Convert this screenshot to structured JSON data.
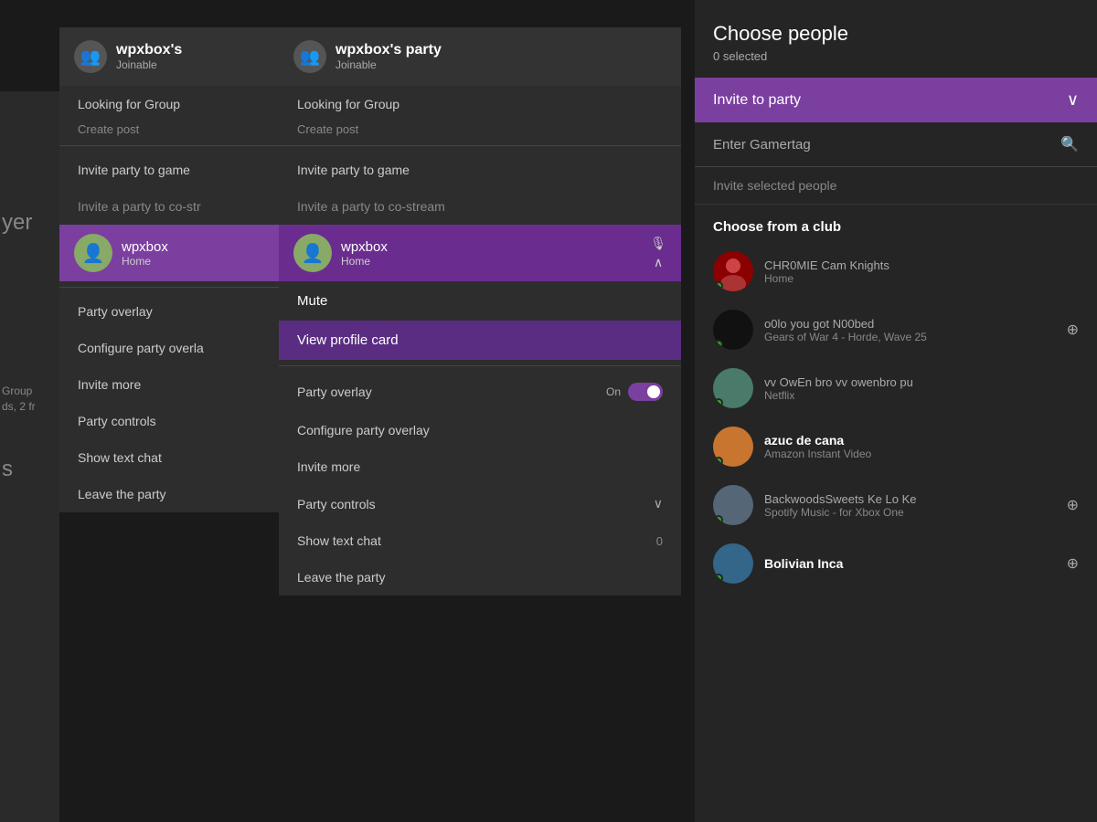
{
  "left_edge": {
    "yer": "yer",
    "group_label": "Group\nds, 2 fr",
    "s": "s"
  },
  "panel1": {
    "header": {
      "name": "wpxbox's",
      "status": "Joinable"
    },
    "menu_items": [
      {
        "label": "Looking for Group",
        "type": "main"
      },
      {
        "label": "Create post",
        "type": "sub"
      },
      {
        "label": "Invite party to game",
        "type": "main"
      },
      {
        "label": "Invite a party to co-str",
        "type": "main"
      },
      {
        "label": "Party overlay",
        "type": "main"
      },
      {
        "label": "Configure party overla",
        "type": "main"
      },
      {
        "label": "Invite more",
        "type": "main"
      },
      {
        "label": "Party controls",
        "type": "main"
      },
      {
        "label": "Show text chat",
        "type": "main"
      },
      {
        "label": "Leave the party",
        "type": "main"
      }
    ],
    "member": {
      "name": "wpxbox",
      "status": "Home"
    }
  },
  "panel2": {
    "header": {
      "name": "wpxbox's party",
      "status": "Joinable"
    },
    "menu_items": [
      {
        "label": "Looking for Group",
        "type": "main"
      },
      {
        "label": "Create post",
        "type": "sub"
      },
      {
        "label": "Invite party to game",
        "type": "main"
      },
      {
        "label": "Invite a party to co-stream",
        "type": "main"
      }
    ],
    "member": {
      "name": "wpxbox",
      "status": "Home"
    },
    "context_menu": [
      {
        "label": "Mute",
        "highlight": false
      },
      {
        "label": "View profile card",
        "highlight": true
      }
    ],
    "bottom_items": [
      {
        "label": "Party overlay",
        "toggle": true,
        "toggle_value": "On",
        "badge": ""
      },
      {
        "label": "Configure party overlay",
        "toggle": false,
        "badge": ""
      },
      {
        "label": "Invite more",
        "toggle": false,
        "badge": ""
      },
      {
        "label": "Party controls",
        "toggle": false,
        "badge": "",
        "chevron": true
      },
      {
        "label": "Show text chat",
        "toggle": false,
        "badge": "0"
      },
      {
        "label": "Leave the party",
        "toggle": false,
        "badge": ""
      }
    ]
  },
  "panel3": {
    "title": "Choose people",
    "subtitle": "0 selected",
    "invite_dropdown": {
      "label": "Invite to party",
      "chevron": "chevron-down"
    },
    "search": {
      "placeholder": "Enter Gamertag"
    },
    "invite_selected_label": "Invite selected people",
    "club_section_title": "Choose from a club",
    "friends": [
      {
        "name": "CHR0MIE",
        "detail_name": "Cam Knights",
        "status": "Home",
        "avatar_color": "#8B0000",
        "online": true,
        "action": ""
      },
      {
        "name": "o0lo",
        "detail_name": "you got N00bed",
        "status": "Gears of War 4 - Horde, Wave 25",
        "avatar_color": "#111111",
        "online": true,
        "action": "invite"
      },
      {
        "name": "vv OwEn bro vv",
        "detail_name": "owenbro pu",
        "status": "Netflix",
        "avatar_color": "#4a7a6a",
        "online": true,
        "action": ""
      },
      {
        "name": "azuc de cana",
        "detail_name": "",
        "status": "Amazon Instant Video",
        "avatar_color": "#c87530",
        "online": true,
        "action": ""
      },
      {
        "name": "BackwoodsSweets",
        "detail_name": "Ke Lo Ke",
        "status": "Spotify Music - for Xbox One",
        "avatar_color": "#556677",
        "online": true,
        "action": "invite"
      },
      {
        "name": "Bolivian Inca",
        "detail_name": "",
        "status": "",
        "avatar_color": "#336688",
        "online": true,
        "action": "invite"
      }
    ]
  },
  "icons": {
    "party_icon": "ꀻ",
    "search": "🔍",
    "chevron_down": "∨",
    "chevron_up": "∧",
    "mic": "🎙",
    "person": "👤",
    "invite": "⊕"
  }
}
